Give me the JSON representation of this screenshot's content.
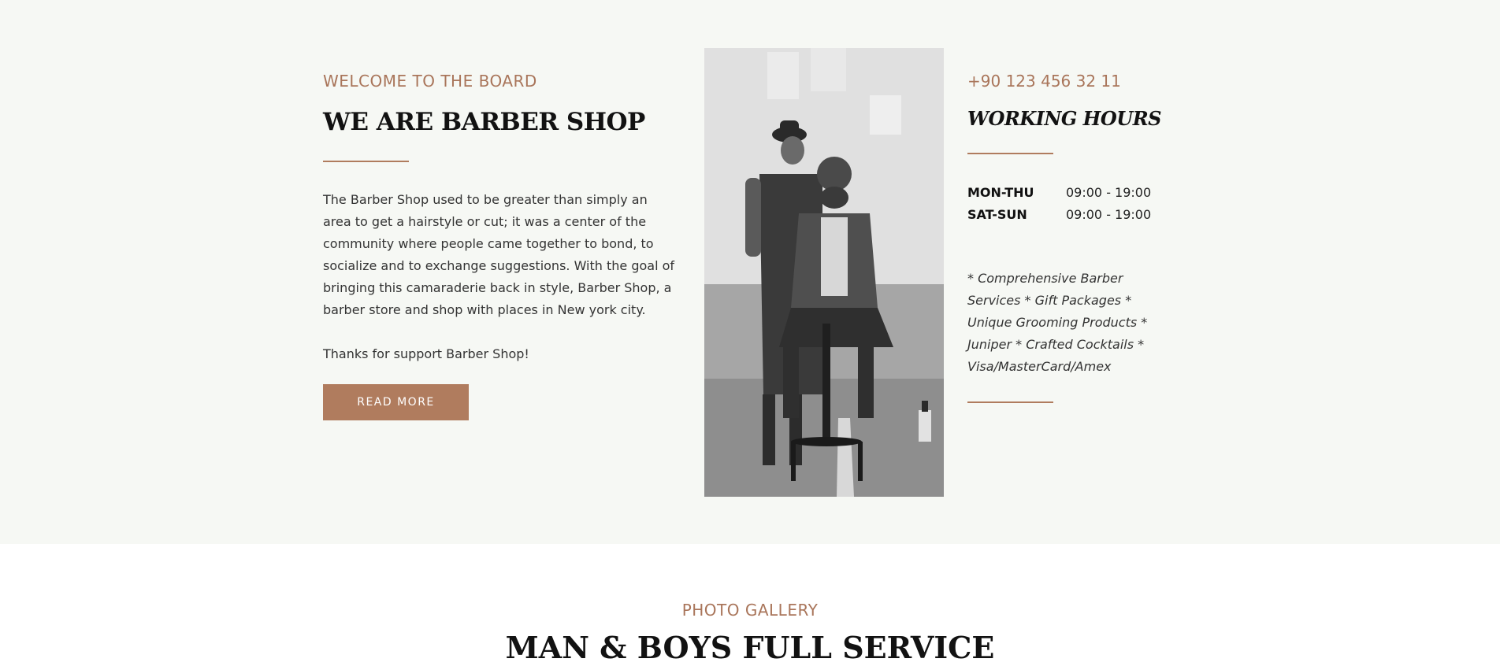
{
  "about": {
    "eyebrow": "WELCOME TO THE BOARD",
    "title": "WE ARE BARBER SHOP",
    "paragraph1": "The Barber Shop used to be greater than simply an area to get a hairstyle or cut; it was a center of the community where people came together to bond, to socialize and to exchange suggestions. With the goal of bringing this camaraderie back in style, Barber Shop, a barber store and shop with places in New york city.",
    "paragraph2": "Thanks for support Barber Shop!",
    "read_more_label": "READ MORE"
  },
  "contact": {
    "phone": "+90 123 456 32 11",
    "hours_title": "WORKING HOURS",
    "hours": [
      {
        "day": "MON-THU",
        "time": "09:00 - 19:00"
      },
      {
        "day": "SAT-SUN",
        "time": "09:00 - 19:00"
      }
    ],
    "services": "* Comprehensive Barber Services * Gift Packages * Unique Grooming Products * Juniper * Crafted Cocktails *  Visa/MasterCard/Amex"
  },
  "gallery": {
    "eyebrow": "PHOTO GALLERY",
    "title": "MAN & BOYS FULL SERVICE"
  },
  "colors": {
    "accent": "#b07c5e",
    "section_bg": "#f6f8f4",
    "heading": "#121212"
  }
}
